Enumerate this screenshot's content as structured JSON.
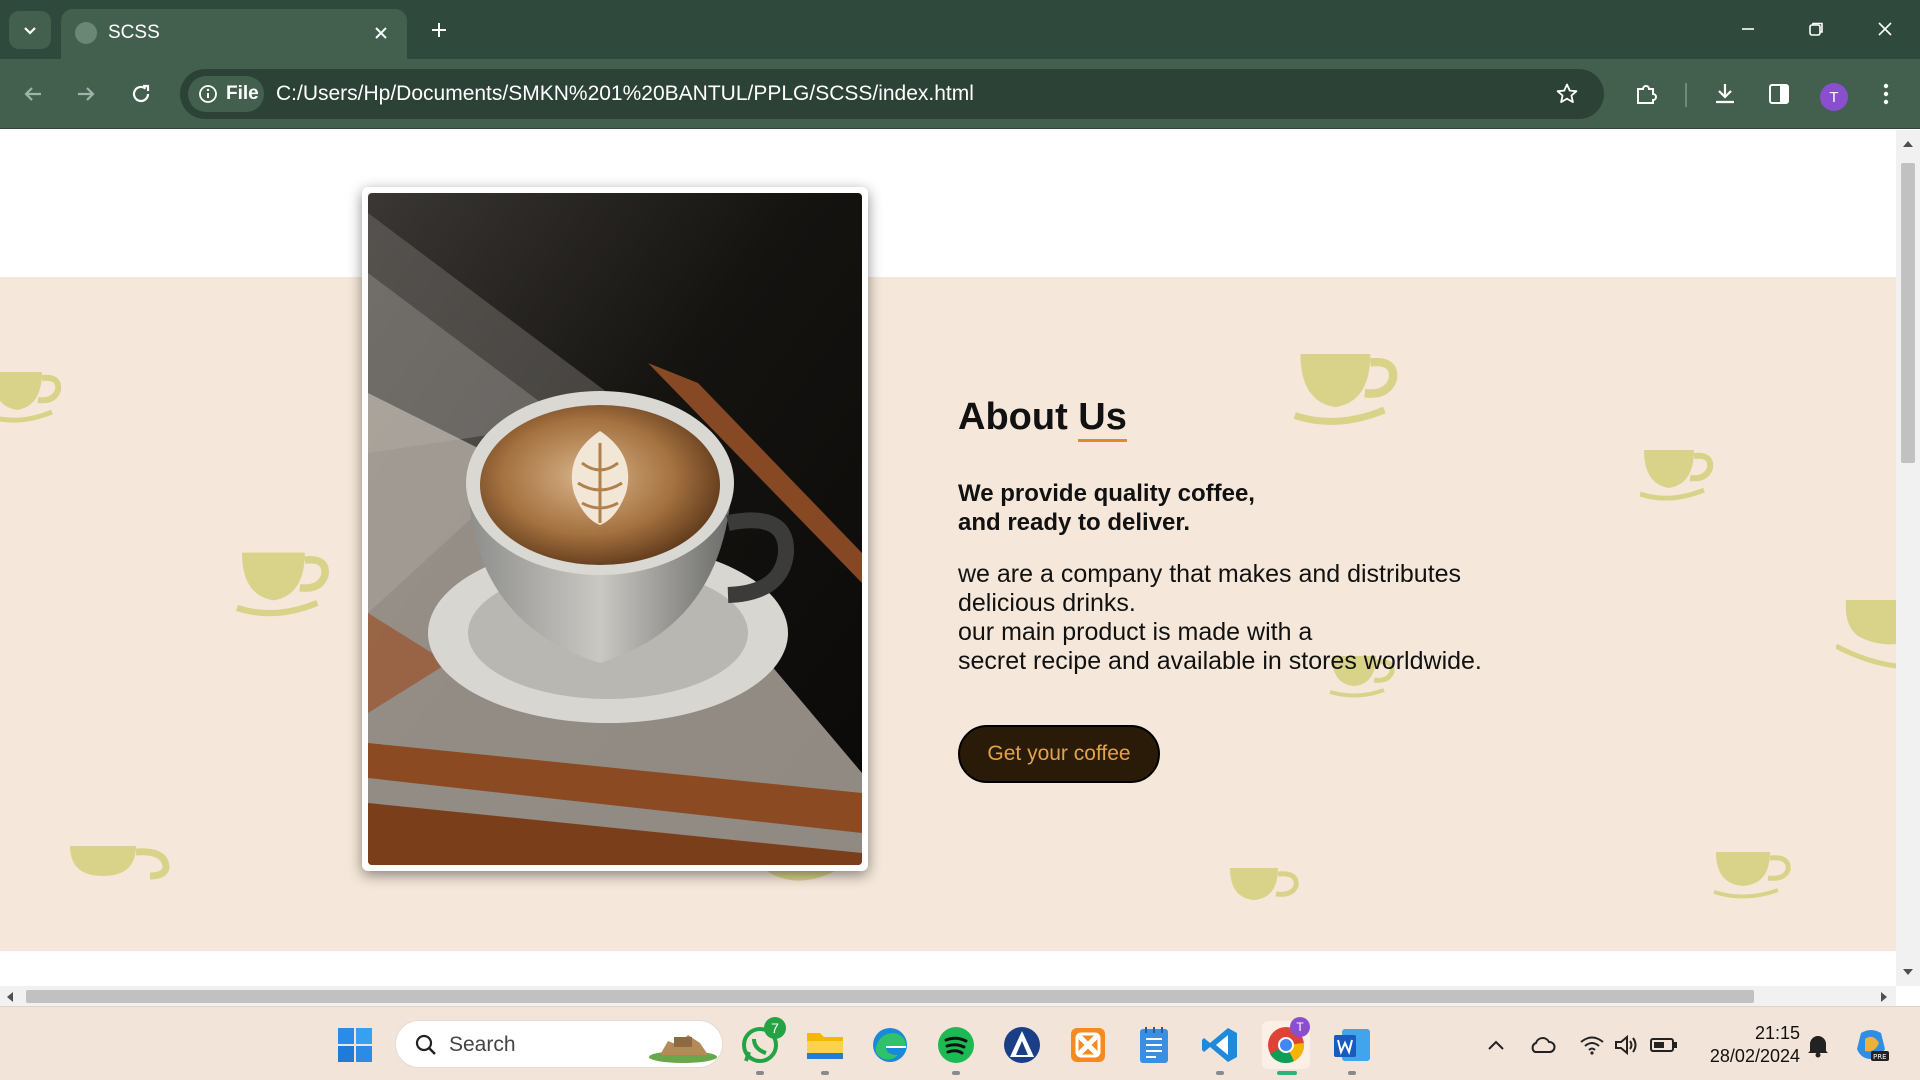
{
  "browser": {
    "tab_title": "SCSS",
    "site_chip_label": "File",
    "url": "C:/Users/Hp/Documents/SMKN%201%20BANTUL/PPLG/SCSS/index.html",
    "profile_initial": "T"
  },
  "page": {
    "about_title_main": "About ",
    "about_title_accent": "Us",
    "tagline_line1": "We provide quality coffee,",
    "tagline_line2": "and ready to deliver.",
    "desc_line1": "we are a company that makes and distributes",
    "desc_line2": "delicious drinks.",
    "desc_line3": "our main product is made with a",
    "desc_line4": "secret recipe and available in stores worldwide.",
    "cta_label": "Get your coffee",
    "colors": {
      "beige": "#f5e8da",
      "accent_underline": "#e08a2c",
      "cta_bg": "#2a1a08",
      "cta_text": "#e3a34a",
      "cup_deco": "#d9d38a"
    }
  },
  "taskbar": {
    "search_label": "Search",
    "whatsapp_badge": "7",
    "chrome_badge": "T",
    "time": "21:15",
    "date": "28/02/2024",
    "icons": [
      "windows-start-icon",
      "whatsapp-icon",
      "file-explorer-icon",
      "edge-icon",
      "spotify-icon",
      "app-icon",
      "xampp-icon",
      "notepad-icon",
      "vscode-icon",
      "chrome-icon",
      "word-icon"
    ]
  }
}
